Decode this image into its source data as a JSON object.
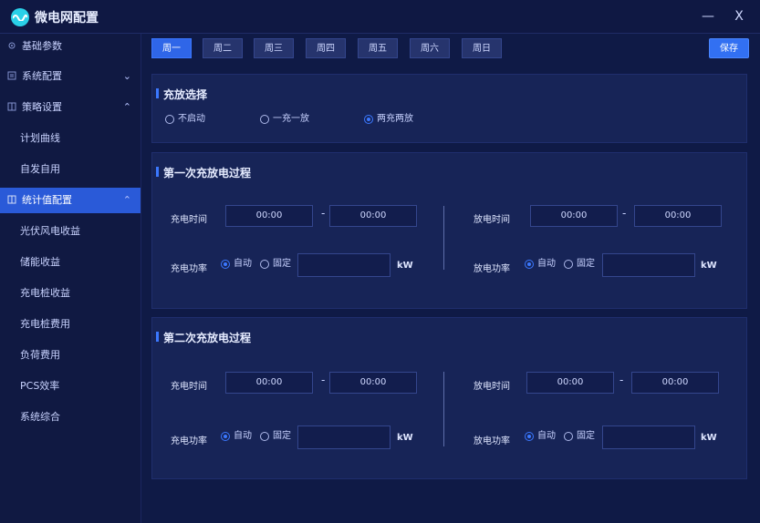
{
  "window": {
    "title": "微电网配置",
    "min_label": "—",
    "close_label": "X"
  },
  "sidebar": {
    "items": [
      {
        "label": "基础参数",
        "icon": "gear-icon"
      },
      {
        "label": "系统配置",
        "icon": "list-icon",
        "chev": "⌄"
      },
      {
        "label": "策略设置",
        "icon": "grid-icon",
        "chev": "⌃"
      },
      {
        "label": "计划曲线"
      },
      {
        "label": "自发自用"
      },
      {
        "label": "统计值配置",
        "icon": "grid-icon",
        "chev": "⌃",
        "active": true
      },
      {
        "label": "光伏风电收益"
      },
      {
        "label": "储能收益"
      },
      {
        "label": "充电桩收益"
      },
      {
        "label": "充电桩费用"
      },
      {
        "label": "负荷费用"
      },
      {
        "label": "PCS效率"
      },
      {
        "label": "系统综合"
      }
    ]
  },
  "tabs": [
    "周一",
    "周二",
    "周三",
    "周四",
    "周五",
    "周六",
    "周日"
  ],
  "active_tab": 0,
  "save_label": "保存",
  "charge_select": {
    "title": "充放选择",
    "options": [
      "不启动",
      "一充一放",
      "两充两放"
    ],
    "selected": 2
  },
  "process1": {
    "title": "第一次充放电过程",
    "charge_time_label": "充电时间",
    "charge_start": "00:00",
    "charge_end": "00:00",
    "discharge_time_label": "放电时间",
    "discharge_start": "00:00",
    "discharge_end": "00:00",
    "charge_power_label": "充电功率",
    "discharge_power_label": "放电功率",
    "auto_label": "自动",
    "fixed_label": "固定",
    "unit": "kW",
    "dash": "-"
  },
  "process2": {
    "title": "第二次充放电过程",
    "charge_time_label": "充电时间",
    "charge_start": "00:00",
    "charge_end": "00:00",
    "discharge_time_label": "放电时间",
    "discharge_start": "00:00",
    "discharge_end": "00:00",
    "charge_power_label": "充电功率",
    "discharge_power_label": "放电功率",
    "auto_label": "自动",
    "fixed_label": "固定",
    "unit": "kW",
    "dash": "-"
  },
  "colors": {
    "accent": "#3b78ff",
    "background": "#0f1a46",
    "panel": "#172457"
  }
}
